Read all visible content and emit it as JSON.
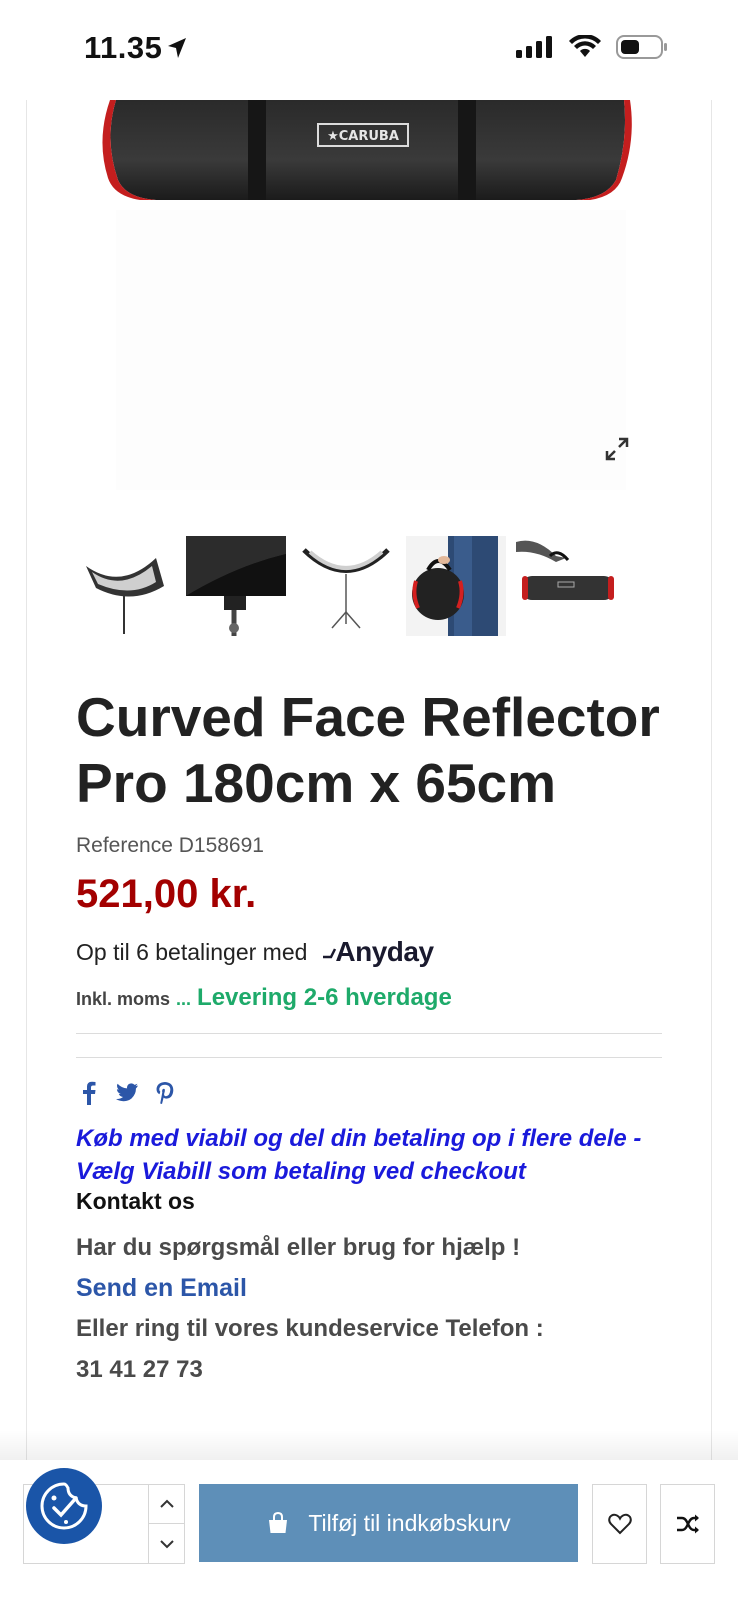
{
  "status_bar": {
    "time": "11.35"
  },
  "product": {
    "brand_on_bag": "★CARUBA",
    "title": "Curved Face Reflector Pro 180cm x 65cm",
    "reference": "Reference D158691",
    "price": "521,00 kr.",
    "installments_text": "Op til 6 betalinger med",
    "installments_provider": "Anyday",
    "tax_text": "Inkl. moms",
    "delivery_dots": "...",
    "delivery_text": "Levering 2-6 hverdage"
  },
  "thumbnails": [
    {
      "name": "reflector-on-stand"
    },
    {
      "name": "reflector-closeup"
    },
    {
      "name": "reflector-curved-stand"
    },
    {
      "name": "bag-carried"
    },
    {
      "name": "bag-handle"
    }
  ],
  "social": {
    "icons": [
      "facebook-icon",
      "twitter-icon",
      "pinterest-icon"
    ]
  },
  "viabill_text": "Køb med viabil og del din betaling op i flere dele - Vælg Viabill som betaling ved checkout",
  "contact": {
    "heading": "Kontakt os",
    "question": "Har du spørgsmål eller brug for hjælp !",
    "email_link": "Send en Email",
    "call_text": "Eller ring til vores kundeservice Telefon :",
    "phone": "31 41 27 73"
  },
  "bottom_bar": {
    "add_to_cart_label": "Tilføj til indkøbskurv",
    "quantity_value": ""
  },
  "colors": {
    "price": "#a30000",
    "delivery": "#1eaa6a",
    "viabill": "#1a1adb",
    "email_link": "#2c56a8",
    "add_cart_button": "#5e8fb8",
    "cookie_button": "#1a55a8"
  }
}
